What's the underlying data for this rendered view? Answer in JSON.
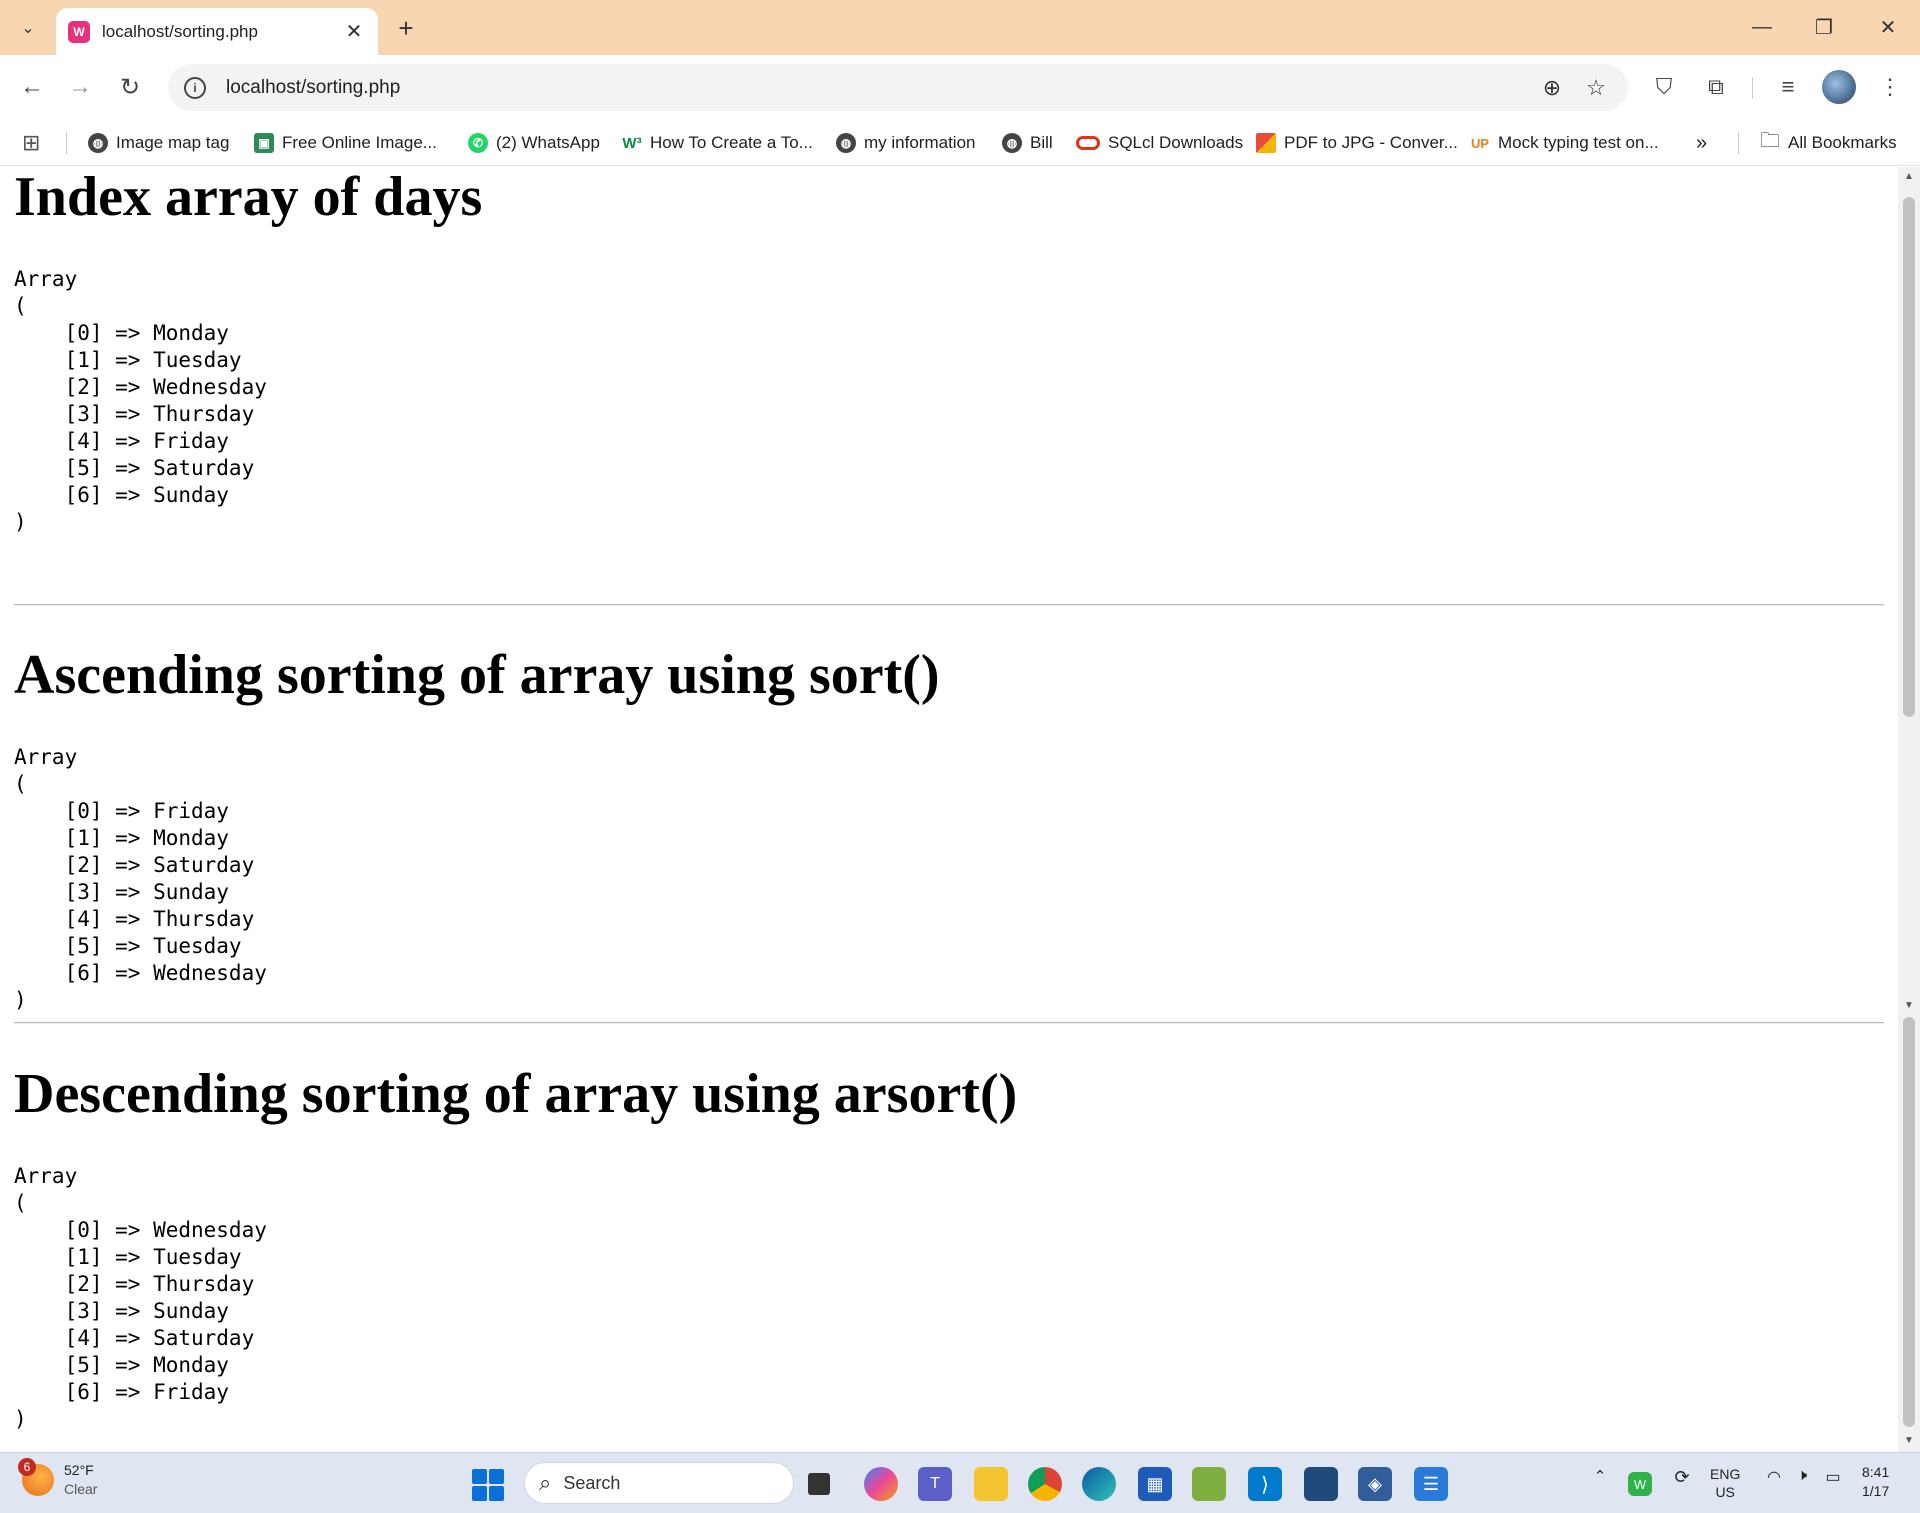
{
  "browser": {
    "tab_title": "localhost/sorting.php",
    "favicon_letter": "W",
    "url": "localhost/sorting.php"
  },
  "bookmarks": [
    {
      "label": "Image map tag",
      "icon": "globe-icon",
      "color": "#444444"
    },
    {
      "label": "Free Online Image...",
      "icon": "image-icon",
      "color": "#2e8b57"
    },
    {
      "label": "(2) WhatsApp",
      "icon": "whatsapp-icon",
      "color": "#25d366"
    },
    {
      "label": "How To Create a To...",
      "icon": "w3-icon",
      "color": "#0c8a3c"
    },
    {
      "label": "my information",
      "icon": "globe-icon",
      "color": "#444444"
    },
    {
      "label": "Bill",
      "icon": "globe-icon",
      "color": "#444444"
    },
    {
      "label": "SQLcl Downloads",
      "icon": "oracle-icon",
      "color": "#e0321c"
    },
    {
      "label": "PDF to JPG - Conver...",
      "icon": "ilovepdf-icon",
      "color": "#e84a3c"
    },
    {
      "label": "Mock typing test on...",
      "icon": "up-icon",
      "color": "#e8811c"
    }
  ],
  "all_bookmarks_label": "All Bookmarks",
  "sections": [
    {
      "heading": "Index array of days",
      "output": "Array\n(\n    [0] => Monday\n    [1] => Tuesday\n    [2] => Wednesday\n    [3] => Thursday\n    [4] => Friday\n    [5] => Saturday\n    [6] => Sunday\n)"
    },
    {
      "heading": "Ascending sorting of array using sort()",
      "output": "Array\n(\n    [0] => Friday\n    [1] => Monday\n    [2] => Saturday\n    [3] => Sunday\n    [4] => Thursday\n    [5] => Tuesday\n    [6] => Wednesday\n)"
    },
    {
      "heading": "Descending sorting of array using arsort()",
      "output": "Array\n(\n    [0] => Wednesday\n    [1] => Tuesday\n    [2] => Thursday\n    [3] => Sunday\n    [4] => Saturday\n    [5] => Monday\n    [6] => Friday\n)"
    }
  ],
  "taskbar": {
    "weather_temp": "52°F",
    "weather_cond": "Clear",
    "weather_badge": "6",
    "search_label": "Search",
    "lang_top": "ENG",
    "lang_bottom": "US",
    "time": "8:41",
    "date": "1/17"
  }
}
